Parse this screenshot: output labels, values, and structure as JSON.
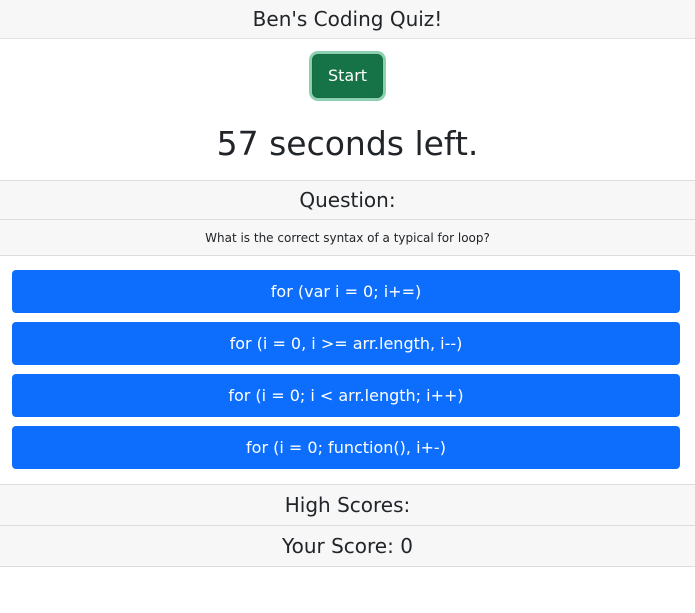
{
  "header": {
    "title": "Ben's Coding Quiz!"
  },
  "controls": {
    "start_label": "Start"
  },
  "timer": {
    "text": "57 seconds left."
  },
  "question": {
    "heading": "Question:",
    "text": "What is the correct syntax of a typical for loop?",
    "answers": [
      "for (var i = 0; i+=)",
      "for (i = 0, i >= arr.length, i--)",
      "for (i = 0; i < arr.length; i++)",
      "for (i = 0; function(), i+-)"
    ]
  },
  "scores": {
    "high_scores_label": "High Scores:",
    "your_score_label": "Your Score: 0"
  },
  "colors": {
    "start_button": "#157347",
    "answer_button": "#0d6efd"
  }
}
